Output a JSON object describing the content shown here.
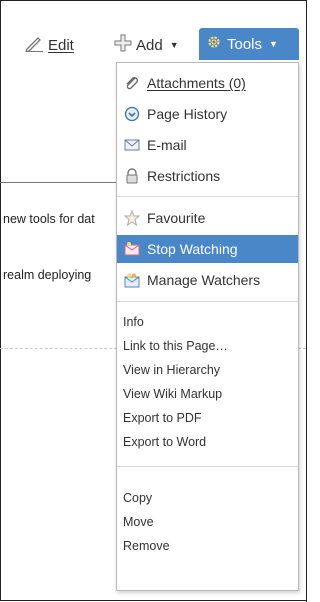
{
  "header": {
    "truncated_title": "new tools for data"
  },
  "toolbar": {
    "edit_label": "Edit",
    "add_label": "Add",
    "tools_label": "Tools"
  },
  "content": {
    "line1": "new tools for dat",
    "line2": "realm deploying"
  },
  "menu": {
    "group1": [
      {
        "label": "Attachments (0)",
        "icon": "paperclip-icon"
      },
      {
        "label": "Page History",
        "icon": "history-icon"
      },
      {
        "label": "E-mail",
        "icon": "envelope-icon"
      },
      {
        "label": "Restrictions",
        "icon": "lock-icon"
      }
    ],
    "group2": [
      {
        "label": "Favourite",
        "icon": "star-icon"
      },
      {
        "label": "Stop Watching",
        "icon": "stop-watching-icon",
        "selected": true
      },
      {
        "label": "Manage Watchers",
        "icon": "watchers-icon"
      }
    ],
    "group3": [
      {
        "label": "Info"
      },
      {
        "label": "Link to this Page…"
      },
      {
        "label": "View in Hierarchy"
      },
      {
        "label": "View Wiki Markup"
      },
      {
        "label": "Export to PDF"
      },
      {
        "label": "Export to Word"
      }
    ],
    "group4": [
      {
        "label": "Copy"
      },
      {
        "label": "Move"
      },
      {
        "label": "Remove"
      }
    ]
  },
  "colors": {
    "accent": "#4a87c8"
  }
}
